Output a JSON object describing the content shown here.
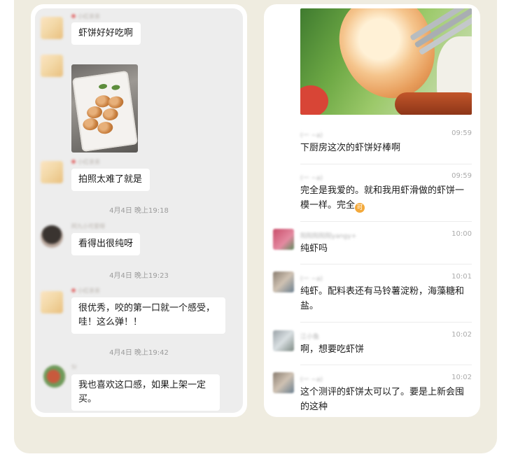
{
  "left_chat": {
    "messages": [
      {
        "sender": "小红亲亲",
        "text": "虾饼好好吃啊"
      },
      {
        "sender": "小红亲亲",
        "type": "image",
        "image_desc": "shrimp cakes on plate"
      },
      {
        "sender": "小红亲亲",
        "text": "拍照太难了就是"
      },
      {
        "sender": "阿九小可爱呀",
        "text": "看得出很纯呀"
      },
      {
        "sender": "小红亲亲",
        "text": "很优秀，咬的第一口就一个感受，哇！这么弹！！"
      },
      {
        "sender": "Sl",
        "text": "我也喜欢这口感，如果上架一定买。"
      }
    ],
    "timestamps": [
      "4月4日 晚上19:18",
      "4月4日 晚上19:23",
      "4月4日 晚上19:42"
    ]
  },
  "right_chat": {
    "messages": [
      {
        "name": "(一 ~a)",
        "time": "09:59",
        "text": "下厨房这次的虾饼好棒啊"
      },
      {
        "name": "(一 ~a)",
        "time": "09:59",
        "text": "完全是我爱的。就和我用虾滑做的虾饼一模一样。完全",
        "emoji": "可"
      },
      {
        "name": "阳阳阳阳阳yangy+",
        "time": "10:00",
        "text": "纯虾吗"
      },
      {
        "name": "(一 ~a)",
        "time": "10:01",
        "text": "纯虾。配料表还有马铃薯淀粉，海藻糖和盐。"
      },
      {
        "name": "江小鱼",
        "time": "10:02",
        "text": "啊，想要吃虾饼"
      },
      {
        "name": "(一 ~a)",
        "time": "10:02",
        "text": "这个测评的虾饼太可以了。要是上新会囤的这种"
      }
    ]
  },
  "colors": {
    "backdrop": "#efece0",
    "bubble": "#ffffff",
    "chat_bg": "#ededed",
    "emoji_coin": "#f3a93b"
  }
}
